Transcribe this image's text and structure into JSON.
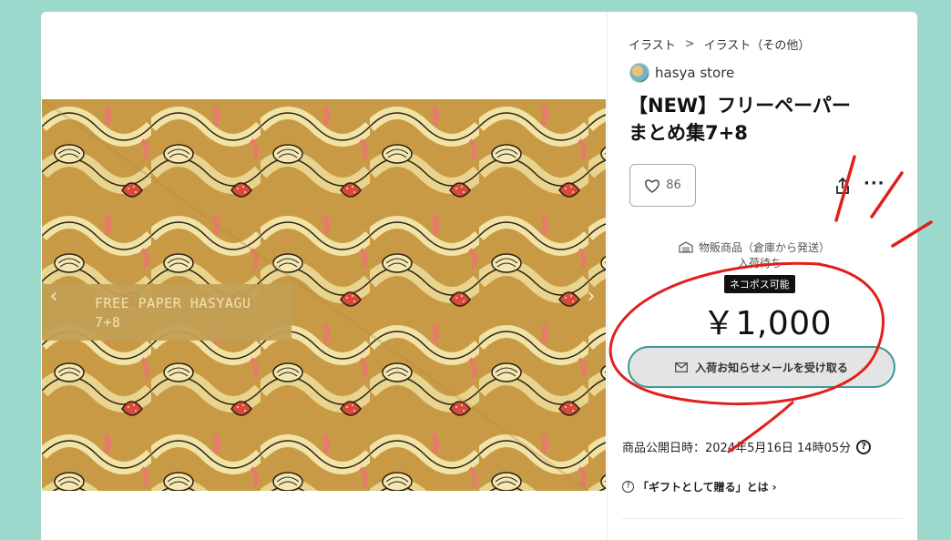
{
  "breadcrumb": {
    "items": [
      "イラスト",
      "イラスト（その他）"
    ],
    "separator": ">"
  },
  "shop": {
    "name": "hasya store"
  },
  "product": {
    "title_line1": "【NEW】フリーペーパー",
    "title_line2": "まとめ集7+8",
    "likes": "86",
    "shipping_type": "物販商品（倉庫から発送）",
    "stock_status": "入荷待ち",
    "shipping_badge": "ネコポス可能",
    "price": "￥1,000",
    "notify_label": "入荷お知らせメールを受け取る",
    "published": "商品公開日時：2024年5月16日 14時05分",
    "gift_label": "「ギフトとして贈る」とは"
  },
  "image": {
    "caption_line1": "FREE PAPER HASYAGU",
    "caption_line2": "7+8"
  },
  "icons": {
    "like": "heart-icon",
    "share": "share-icon",
    "more": "more-icon",
    "warehouse": "warehouse-icon",
    "mail": "mail-icon",
    "help": "help-icon",
    "chevron": "chevron-right-icon"
  },
  "colors": {
    "page_background": "#9dd8cc",
    "notify_border": "#3c9a98",
    "annotation_red": "#e0201c"
  }
}
